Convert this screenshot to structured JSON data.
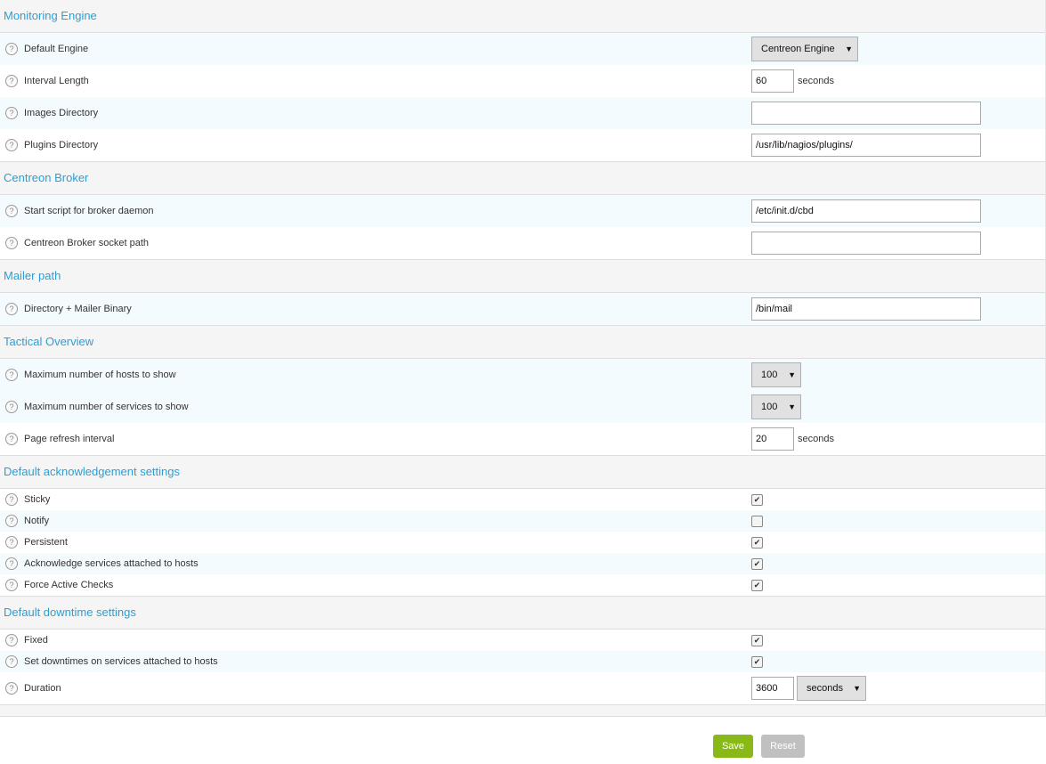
{
  "sections": {
    "monitoring_engine": "Monitoring Engine",
    "centreon_broker": "Centreon Broker",
    "mailer_path": "Mailer path",
    "tactical_overview": "Tactical Overview",
    "ack_settings": "Default acknowledgement settings",
    "downtime_settings": "Default downtime settings"
  },
  "fields": {
    "default_engine": {
      "label": "Default Engine",
      "value": "Centreon Engine"
    },
    "interval_length": {
      "label": "Interval Length",
      "value": "60",
      "unit": "seconds"
    },
    "images_directory": {
      "label": "Images Directory",
      "value": ""
    },
    "plugins_directory": {
      "label": "Plugins Directory",
      "value": "/usr/lib/nagios/plugins/"
    },
    "broker_start_script": {
      "label": "Start script for broker daemon",
      "value": "/etc/init.d/cbd"
    },
    "broker_socket_path": {
      "label": "Centreon Broker socket path",
      "value": ""
    },
    "mailer_binary": {
      "label": "Directory + Mailer Binary",
      "value": "/bin/mail"
    },
    "max_hosts": {
      "label": "Maximum number of hosts to show",
      "value": "100"
    },
    "max_services": {
      "label": "Maximum number of services to show",
      "value": "100"
    },
    "page_refresh": {
      "label": "Page refresh interval",
      "value": "20",
      "unit": "seconds"
    },
    "sticky": {
      "label": "Sticky",
      "checked": true
    },
    "notify": {
      "label": "Notify",
      "checked": false
    },
    "persistent": {
      "label": "Persistent",
      "checked": true
    },
    "ack_services": {
      "label": "Acknowledge services attached to hosts",
      "checked": true
    },
    "force_active": {
      "label": "Force Active Checks",
      "checked": true
    },
    "fixed": {
      "label": "Fixed",
      "checked": true
    },
    "downtime_services": {
      "label": "Set downtimes on services attached to hosts",
      "checked": true
    },
    "duration": {
      "label": "Duration",
      "value": "3600",
      "unit": "seconds"
    }
  },
  "help_glyph": "?",
  "check_glyph": "✔",
  "dropdown_glyph": "▼",
  "buttons": {
    "save": "Save",
    "reset": "Reset"
  },
  "colors": {
    "accent": "#2a9fd6",
    "save": "#88b917",
    "reset": "#c0c0c0"
  }
}
